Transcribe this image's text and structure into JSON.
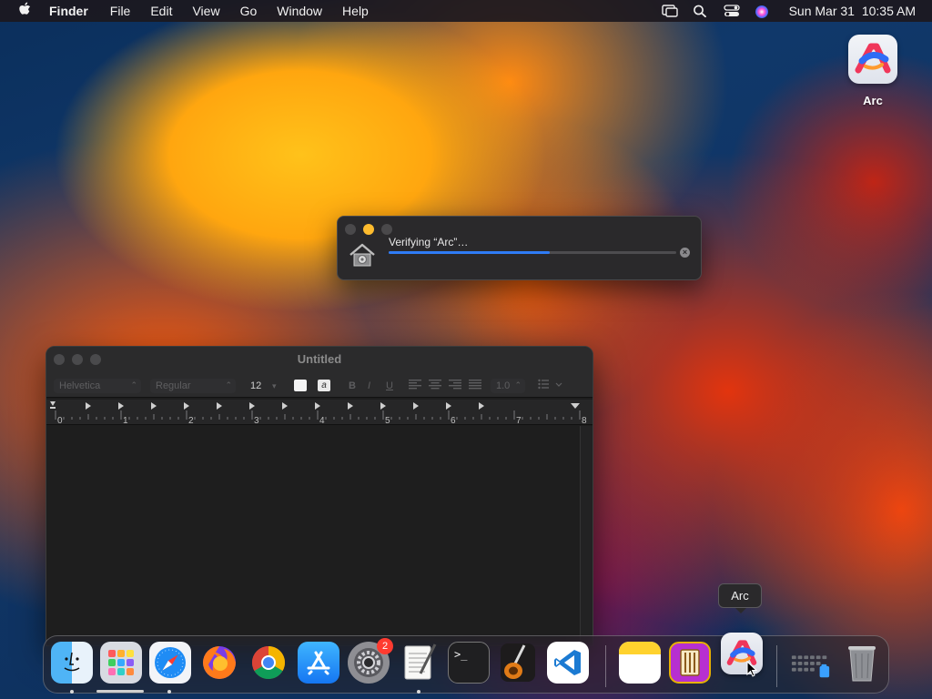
{
  "menubar": {
    "app_name": "Finder",
    "menus": [
      "File",
      "Edit",
      "View",
      "Go",
      "Window",
      "Help"
    ],
    "date": "Sun Mar 31",
    "time": "10:35 AM",
    "status_icons": [
      "screen-mirroring-icon",
      "spotlight-search-icon",
      "control-center-icon",
      "siri-icon"
    ]
  },
  "desktop": {
    "icon_label": "Arc"
  },
  "verify_dialog": {
    "title": "Verifying “Arc”…",
    "progress": 0.56
  },
  "textedit": {
    "title": "Untitled",
    "font_family": "Helvetica",
    "font_style": "Regular",
    "font_size": "12",
    "line_spacing": "1.0",
    "ruler_marks": [
      "0",
      "1",
      "2",
      "3",
      "4",
      "5",
      "6",
      "7",
      "8"
    ]
  },
  "tooltip": {
    "label": "Arc"
  },
  "dock": {
    "settings_badge": "2",
    "apps": [
      "Finder",
      "Launchpad",
      "Safari",
      "Firefox",
      "Chrome",
      "App Store",
      "System Settings",
      "TextEdit",
      "Terminal",
      "GarageBand",
      "Visual Studio Code",
      "Notes",
      "Hammerspoon",
      "Arc",
      "Applications",
      "Trash"
    ]
  },
  "colors": {
    "progress_blue": "#2f7cf6",
    "tl_yellow": "#febc2e",
    "badge_red": "#ff3b30"
  }
}
